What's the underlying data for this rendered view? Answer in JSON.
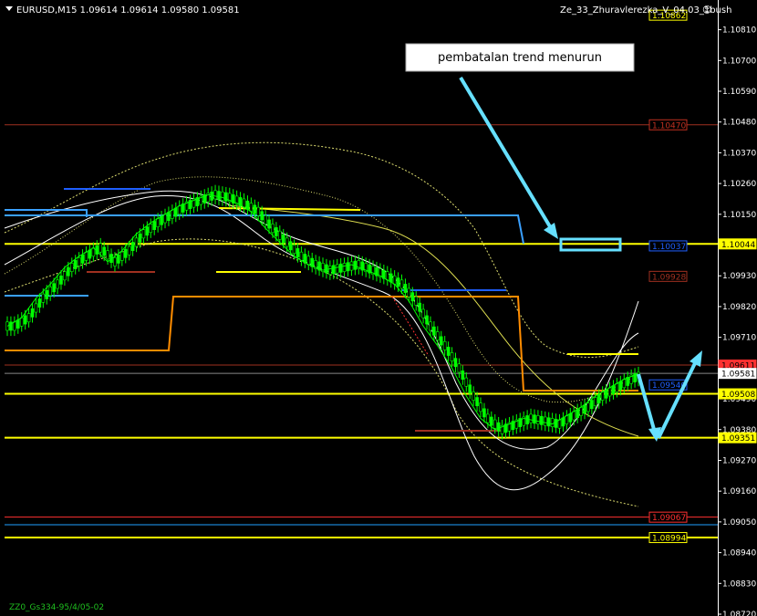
{
  "header": {
    "symbol_info": "EURUSD,M15  1.09614 1.09614 1.09580 1.09581",
    "indicator_name": "Ze_33_Zhuravlerezka_V_04.03_1bush",
    "smiley": "☺"
  },
  "annotation": {
    "text": "pembatalan trend menurun"
  },
  "footer": {
    "text": "ZZ0_Gs334-95/4/05-02"
  },
  "colors": {
    "background": "#000000",
    "candle": "#00ff00",
    "yellow_line": "#ffff00",
    "orange_line": "#ff8c00",
    "cyan_arrow": "#66e0ff",
    "blue_line": "#1f5fff",
    "red_line": "#a03020"
  },
  "chart_data": {
    "type": "line",
    "symbol": "EURUSD",
    "timeframe": "M15",
    "ylim": [
      1.0872,
      1.109
    ],
    "y_ticks": [
      "1.10810",
      "1.10700",
      "1.10590",
      "1.10480",
      "1.10370",
      "1.10260",
      "1.10150",
      "1.09930",
      "1.09820",
      "1.09710",
      "1.09490",
      "1.09380",
      "1.09270",
      "1.09160",
      "1.09050",
      "1.08940",
      "1.08830",
      "1.08720"
    ],
    "price_labels": [
      {
        "text": "1.10862",
        "price": 1.10862,
        "color": "#ffff00"
      },
      {
        "text": "1.10470",
        "price": 1.1047,
        "color": "#c03020"
      },
      {
        "text": "1.10037",
        "price": 1.10037,
        "color": "#1f5fff"
      },
      {
        "text": "1.10044",
        "price": 1.10044,
        "color": "#ffff00",
        "filled": true
      },
      {
        "text": "1.09928",
        "price": 1.09928,
        "color": "#a03020"
      },
      {
        "text": "1.09611",
        "price": 1.09611,
        "color": "#ff3030",
        "filled": true
      },
      {
        "text": "1.09581",
        "price": 1.09581,
        "color": "#ffffff",
        "filled": true
      },
      {
        "text": "1.09540",
        "price": 1.0954,
        "color": "#1f5fff"
      },
      {
        "text": "1.09508",
        "price": 1.09508,
        "color": "#ffff00",
        "filled": true
      },
      {
        "text": "1.09351",
        "price": 1.09351,
        "color": "#ffff00",
        "filled": true
      },
      {
        "text": "1.09067",
        "price": 1.09067,
        "color": "#ff3030"
      },
      {
        "text": "1.08994",
        "price": 1.08994,
        "color": "#ffff00"
      }
    ],
    "horizontal_levels": [
      {
        "price": 1.1047,
        "color": "#a03020"
      },
      {
        "price": 1.10044,
        "color": "#ffff00"
      },
      {
        "price": 1.09611,
        "color": "#a03020"
      },
      {
        "price": 1.09581,
        "color": "#888888"
      },
      {
        "price": 1.09508,
        "color": "#ffff00"
      },
      {
        "price": 1.09351,
        "color": "#ffff00"
      },
      {
        "price": 1.09067,
        "color": "#ff3030"
      },
      {
        "price": 1.0904,
        "color": "#1f9fff"
      },
      {
        "price": 1.08994,
        "color": "#ffff00"
      }
    ],
    "close_series": [
      1.0975,
      1.0978,
      1.0985,
      1.099,
      1.0996,
      1.1,
      1.1003,
      1.0998,
      1.1002,
      1.1008,
      1.1012,
      1.1015,
      1.1018,
      1.102,
      1.1022,
      1.1021,
      1.1019,
      1.1016,
      1.101,
      1.1005,
      1.1,
      1.0997,
      1.0995,
      1.0996,
      1.0997,
      1.0995,
      1.0993,
      1.099,
      1.0984,
      1.0975,
      1.0968,
      1.096,
      1.095,
      1.0942,
      1.0938,
      1.094,
      1.0942,
      1.0941,
      1.094,
      1.0943,
      1.0946,
      1.095,
      1.0953,
      1.0956,
      1.0958
    ]
  }
}
